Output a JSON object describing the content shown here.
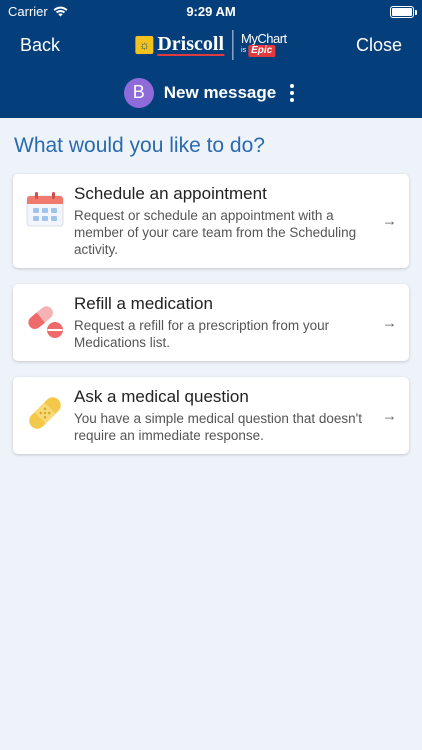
{
  "status_bar": {
    "carrier": "Carrier",
    "time": "9:29 AM"
  },
  "nav": {
    "back_label": "Back",
    "close_label": "Close",
    "brand_name": "Driscoll",
    "mychart_label": "MyChart",
    "mychart_is": "is",
    "epic_label": "Epic"
  },
  "subheader": {
    "avatar_initial": "B",
    "title": "New message"
  },
  "prompt": "What would you like to do?",
  "options": [
    {
      "title": "Schedule an appointment",
      "description": "Request or schedule an appointment with a member of your care team from the Scheduling activity.",
      "icon": "calendar-icon"
    },
    {
      "title": "Refill a medication",
      "description": "Request a refill for a prescription from your Medications list.",
      "icon": "pill-icon"
    },
    {
      "title": "Ask a medical question",
      "description": "You have a simple medical question that doesn't require an immediate response.",
      "icon": "bandage-icon"
    }
  ],
  "colors": {
    "header": "#053f7b",
    "accent": "#2a6bb0",
    "avatar": "#8e6bd8",
    "background": "#eef3fa"
  }
}
